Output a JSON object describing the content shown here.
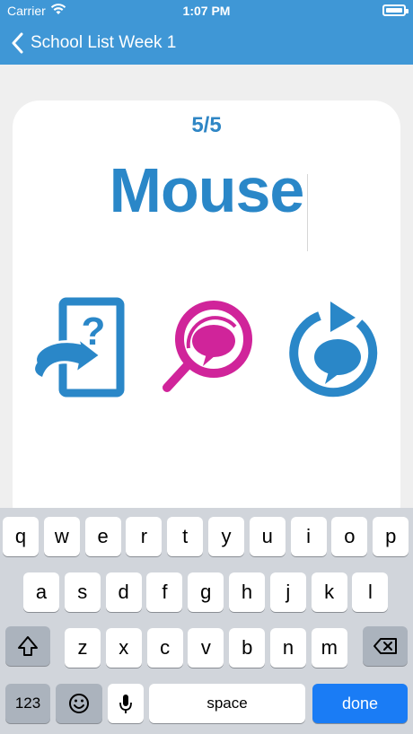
{
  "status_bar": {
    "carrier": "Carrier",
    "time": "1:07 PM"
  },
  "nav": {
    "back_label": "School List Week 1"
  },
  "card": {
    "counter": "5/5",
    "word": "Mouse",
    "actions": [
      {
        "name": "flip-card",
        "icon": "card-flip-question-icon"
      },
      {
        "name": "search-speech",
        "icon": "magnifier-speech-icon"
      },
      {
        "name": "replay-speech",
        "icon": "refresh-speech-icon"
      }
    ]
  },
  "keyboard": {
    "row1": [
      "q",
      "w",
      "e",
      "r",
      "t",
      "y",
      "u",
      "i",
      "o",
      "p"
    ],
    "row2": [
      "a",
      "s",
      "d",
      "f",
      "g",
      "h",
      "j",
      "k",
      "l"
    ],
    "row3": [
      "z",
      "x",
      "c",
      "v",
      "b",
      "n",
      "m"
    ],
    "numbers_label": "123",
    "space_label": "space",
    "done_label": "done"
  },
  "colors": {
    "nav": "#3f97d6",
    "accent_blue": "#2a87c8",
    "magenta": "#d0249a",
    "done_key": "#1a7cf5"
  }
}
